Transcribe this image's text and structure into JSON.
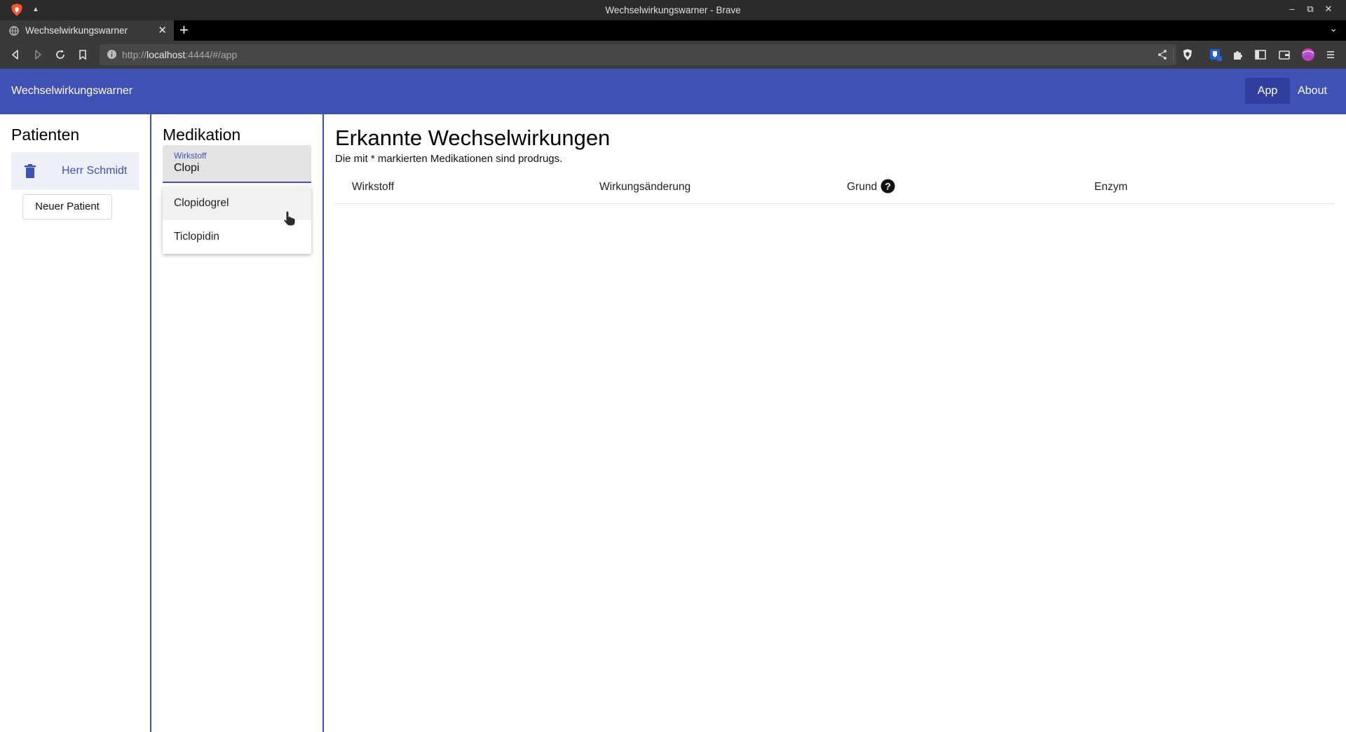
{
  "browser": {
    "window_title": "Wechselwirkungswarner - Brave",
    "tab_title": "Wechselwirkungswarner",
    "url_prefix": "http://",
    "url_host": "localhost",
    "url_rest": ":4444/#/app"
  },
  "appbar": {
    "title": "Wechselwirkungswarner",
    "nav_app": "App",
    "nav_about": "About",
    "color": "#3f51b5",
    "active_color": "#303f9f"
  },
  "patients": {
    "heading": "Patienten",
    "items": [
      {
        "name": "Herr Schmidt",
        "icon": "trash-icon"
      }
    ],
    "new_button": "Neuer Patient"
  },
  "medication": {
    "heading": "Medikation",
    "field_label": "Wirkstoff",
    "field_value": "Clopi",
    "suggestions": [
      "Clopidogrel",
      "Ticlopidin"
    ]
  },
  "interactions": {
    "heading": "Erkannte Wechselwirkungen",
    "subtitle": "Die mit * markierten Medikationen sind prodrugs.",
    "columns": [
      "Wirkstoff",
      "Wirkungsänderung",
      "Grund",
      "Enzym"
    ],
    "rows": []
  }
}
